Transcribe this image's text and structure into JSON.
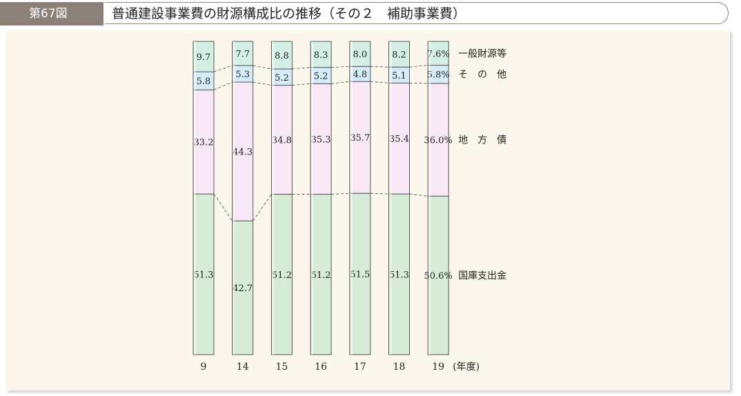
{
  "header": {
    "figure_label": "第67図",
    "title": "普通建設事業費の財源構成比の推移（その２　補助事業費）"
  },
  "chart_data": {
    "type": "bar",
    "stacked": true,
    "percent_stacked": true,
    "categories": [
      "9",
      "14",
      "15",
      "16",
      "17",
      "18",
      "19"
    ],
    "x_unit_label": "(年度)",
    "series": [
      {
        "name": "国庫支出金",
        "color": "#d6ecd6",
        "values": [
          51.3,
          42.7,
          51.2,
          51.2,
          51.5,
          51.3,
          50.6
        ],
        "labels": [
          "51.3",
          "42.7",
          "51.2",
          "51.2",
          "51.5",
          "51.3",
          "50.6%"
        ]
      },
      {
        "name": "地方債",
        "color": "#f8e8f6",
        "values": [
          33.2,
          44.3,
          34.8,
          35.3,
          35.7,
          35.4,
          36.0
        ],
        "labels": [
          "33.2",
          "44.3",
          "34.8",
          "35.3",
          "35.7",
          "35.4",
          "36.0%"
        ]
      },
      {
        "name": "その他",
        "color": "#d5ecf8",
        "values": [
          5.8,
          5.3,
          5.2,
          5.2,
          4.8,
          5.1,
          5.8
        ],
        "labels": [
          "5.8",
          "5.3",
          "5.2",
          "5.2",
          "4.8",
          "5.1",
          "5.8%"
        ]
      },
      {
        "name": "一般財源等",
        "color": "#d3efe6",
        "values": [
          9.7,
          7.7,
          8.8,
          8.3,
          8.0,
          8.2,
          7.6
        ],
        "labels": [
          "9.7",
          "7.7",
          "8.8",
          "8.3",
          "8.0",
          "8.2",
          "7.6%"
        ]
      }
    ],
    "legend_display_names": [
      "国庫支出金",
      "地　方　債",
      "そ　の　他",
      "一般財源等"
    ],
    "legend_placement": "right",
    "ylim": [
      0,
      100
    ],
    "grid": false
  }
}
